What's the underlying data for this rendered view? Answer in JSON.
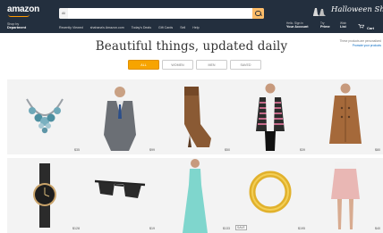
{
  "header": {
    "logo": "amazon",
    "shop_by_1": "Shop by",
    "shop_by_2": "Department",
    "search_category": "All",
    "search_placeholder": "",
    "nav_links": [
      "Recently Viewed",
      "shahana's Amazon.com",
      "Today's Deals",
      "Gift Cards",
      "Sell",
      "Help"
    ],
    "promo_text": "Halloween Shop",
    "account_line1": "Hello. Sign in",
    "account_line2": "Your Account",
    "prime_line1": "Try",
    "prime_line2": "Prime",
    "list_line1": "Wish",
    "list_line2": "List",
    "cart_label": "Cart"
  },
  "page": {
    "title": "Beautiful things, updated daily",
    "side_note_1": "These products are personalized",
    "side_note_2": "Promote your products"
  },
  "tabs": [
    {
      "label": "ALL",
      "active": true
    },
    {
      "label": "WOMEN",
      "active": false
    },
    {
      "label": "MEN",
      "active": false
    },
    {
      "label": "SAVED",
      "active": false
    }
  ],
  "products": [
    {
      "name": "necklace",
      "price": "$35"
    },
    {
      "name": "suit",
      "price": "$99"
    },
    {
      "name": "boots",
      "price": "$50"
    },
    {
      "name": "cardigan",
      "price": "$39"
    },
    {
      "name": "coat",
      "price": "$80"
    },
    {
      "name": "watch",
      "price": "$128"
    },
    {
      "name": "sunglasses",
      "price": "$19"
    },
    {
      "name": "dress",
      "price": "$133"
    },
    {
      "name": "ring",
      "price": "$195"
    },
    {
      "name": "skirt",
      "price": "$40"
    }
  ],
  "save_badge": "SAVE"
}
